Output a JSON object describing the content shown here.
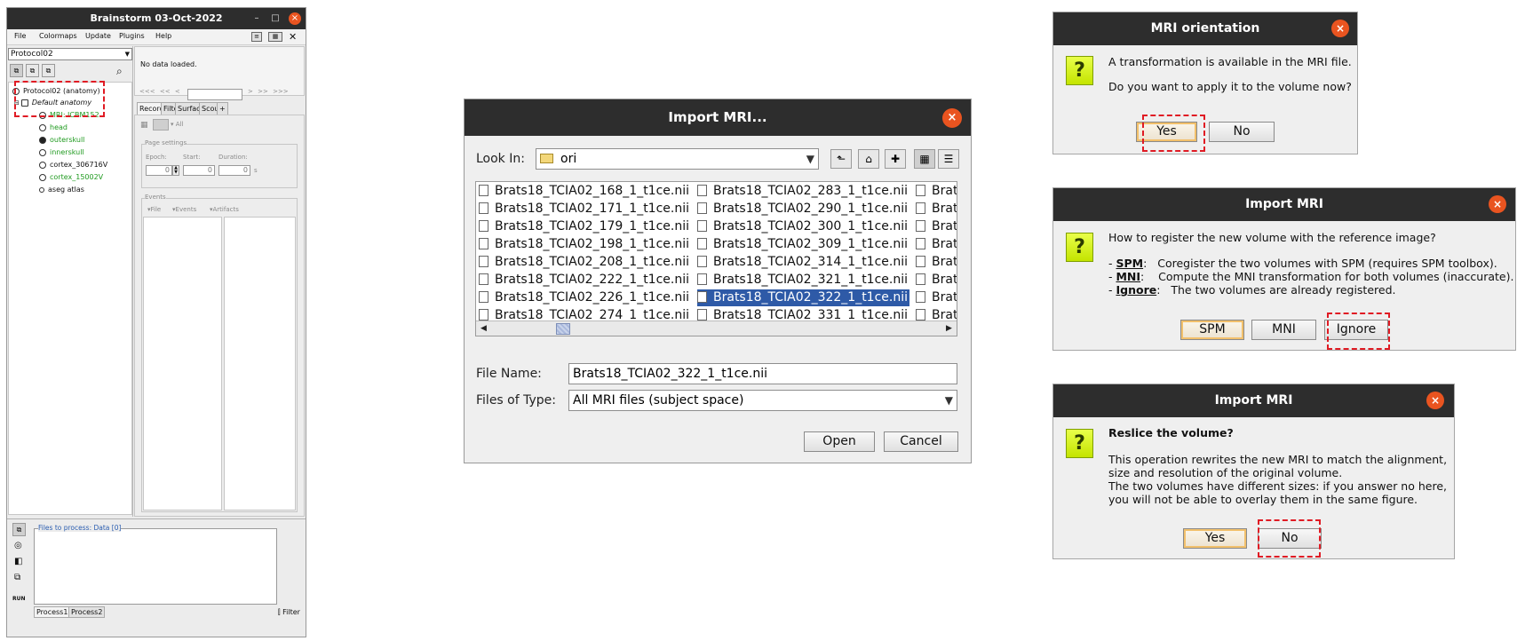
{
  "brainstorm": {
    "title": "Brainstorm 03-Oct-2022",
    "menu": [
      "File",
      "Colormaps",
      "Update",
      "Plugins",
      "Help"
    ],
    "protocol": "Protocol02",
    "tree": {
      "root": "Protocol02 (anatomy)",
      "subject": "Default anatomy",
      "items": [
        {
          "label": "MRI: ICBM152",
          "color": "#1f9a1f"
        },
        {
          "label": "head",
          "color": "#1f9a1f"
        },
        {
          "label": "outerskull",
          "color": "#1f9a1f"
        },
        {
          "label": "innerskull",
          "color": "#1f9a1f"
        },
        {
          "label": "cortex_306716V",
          "color": "#111111"
        },
        {
          "label": "cortex_15002V",
          "color": "#1f9a1f"
        },
        {
          "label": "aseg atlas",
          "color": "#111111"
        }
      ]
    },
    "status": "No data loaded.",
    "time_nav": [
      "<<<",
      "<<",
      "<",
      ">",
      ">>",
      ">>>"
    ],
    "tabs": [
      "Record",
      "Filter",
      "Surface",
      "Scout",
      "+"
    ],
    "all_label": "All",
    "page_settings": {
      "title": "Page settings",
      "epoch_label": "Epoch:",
      "start_label": "Start:",
      "duration_label": "Duration:",
      "epoch_value": "0",
      "start_value": "0",
      "duration_value": "0",
      "unit": "s"
    },
    "events": {
      "title": "Events",
      "file_menu": "File",
      "events_menu": "Events",
      "artifacts_menu": "Artifacts"
    },
    "files_to_process": "Files to process: Data [0]",
    "process_tabs": [
      "Process1",
      "Process2"
    ],
    "filter_label": "Filter",
    "run_label": "RUN"
  },
  "import_dialog": {
    "title": "Import MRI...",
    "look_in_label": "Look In:",
    "look_in_value": "ori",
    "files": [
      "Brats18_TCIA02_168_1_t1ce.nii",
      "Brats18_TCIA02_171_1_t1ce.nii",
      "Brats18_TCIA02_179_1_t1ce.nii",
      "Brats18_TCIA02_198_1_t1ce.nii",
      "Brats18_TCIA02_208_1_t1ce.nii",
      "Brats18_TCIA02_222_1_t1ce.nii",
      "Brats18_TCIA02_226_1_t1ce.nii",
      "Brats18_TCIA02_274_1_t1ce.nii",
      "Brats18_TCIA02_283_1_t1ce.nii",
      "Brats18_TCIA02_290_1_t1ce.nii",
      "Brats18_TCIA02_300_1_t1ce.nii",
      "Brats18_TCIA02_309_1_t1ce.nii",
      "Brats18_TCIA02_314_1_t1ce.nii",
      "Brats18_TCIA02_321_1_t1ce.nii",
      "Brats18_TCIA02_322_1_t1ce.nii",
      "Brats18_TCIA02_331_1_t1ce.nii"
    ],
    "selected_file": "Brats18_TCIA02_322_1_t1ce.nii",
    "third_column_partial": "Brat",
    "file_name_label": "File Name:",
    "file_name_value": "Brats18_TCIA02_322_1_t1ce.nii",
    "files_of_type_label": "Files of Type:",
    "files_of_type_value": "All MRI files (subject space)",
    "open_label": "Open",
    "cancel_label": "Cancel"
  },
  "orientation_dialog": {
    "title": "MRI orientation",
    "line1": "A transformation is available in the MRI file.",
    "line2": "Do you want to apply it to the volume now?",
    "yes_label": "Yes",
    "no_label": "No"
  },
  "register_dialog": {
    "title": "Import MRI",
    "question": "How to register the new volume with the reference image?",
    "options": [
      {
        "key": "SPM",
        "desc": "   Coregister the two volumes with SPM (requires SPM toolbox)."
      },
      {
        "key": "MNI",
        "desc": "    Compute the MNI transformation for both volumes (inaccurate)."
      },
      {
        "key": "Ignore",
        "desc": "   The two volumes are already registered."
      }
    ],
    "spm_label": "SPM",
    "mni_label": "MNI",
    "ignore_label": "Ignore"
  },
  "reslice_dialog": {
    "title": "Import MRI",
    "heading": "Reslice the volume?",
    "line1": "This operation rewrites the new MRI to match the alignment,",
    "line2": "size and resolution of the original volume.",
    "line3": "The two volumes have different sizes: if you answer no here,",
    "line4": "you will not be able to overlay them in the same figure.",
    "yes_label": "Yes",
    "no_label": "No"
  },
  "colors": {
    "titlebar": "#2d2d2d",
    "close_button": "#e95420",
    "selection": "#2e5aa7",
    "highlight_box": "#e01b24",
    "question_icon": "#d4f000"
  }
}
